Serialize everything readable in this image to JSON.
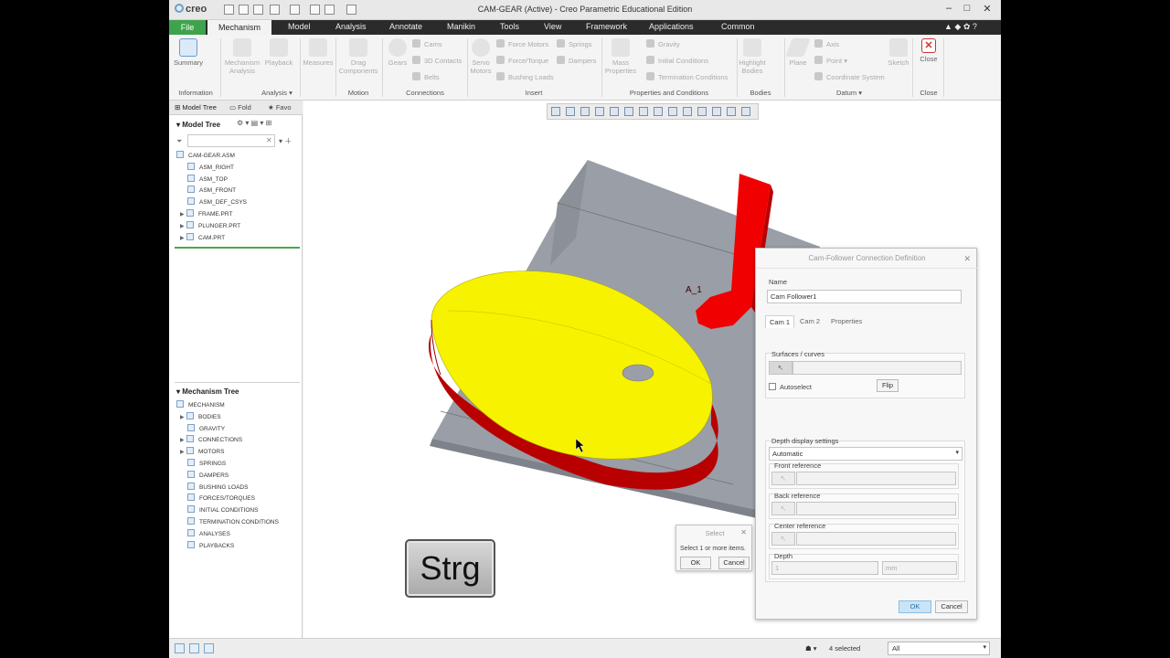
{
  "window": {
    "app_logo": "creo",
    "title": "CAM-GEAR (Active) - Creo Parametric Educational Edition"
  },
  "menu": {
    "file": "File",
    "active_tab": "Mechanism",
    "items": [
      "Model",
      "Analysis",
      "Annotate",
      "Manikin",
      "Tools",
      "View",
      "Framework",
      "Applications",
      "Common"
    ]
  },
  "ribbon": {
    "summary": "Summary",
    "mechanism_analysis": "Mechanism Analysis",
    "playback": "Playback",
    "measures": "Measures",
    "drag_components": "Drag Components",
    "gears": "Gears",
    "cams": "Cams",
    "contacts_3d": "3D Contacts",
    "belts": "Belts",
    "servo_motors": "Servo Motors",
    "force_motors": "Force Motors",
    "force_torque": "Force/Torque",
    "bushing_loads": "Bushing Loads",
    "springs": "Springs",
    "dampers": "Dampers",
    "mass_properties": "Mass Properties",
    "gravity": "Gravity",
    "initial_conditions": "Initial Conditions",
    "termination_conditions": "Termination Conditions",
    "highlight_bodies": "Highlight Bodies",
    "plane": "Plane",
    "axis": "Axis",
    "point": "Point",
    "coordinate_system": "Coordinate System",
    "sketch": "Sketch",
    "close": "Close",
    "groups": {
      "information": "Information",
      "analysis": "Analysis",
      "motion": "Motion",
      "connections": "Connections",
      "insert": "Insert",
      "properties": "Properties and Conditions",
      "bodies": "Bodies",
      "datum": "Datum",
      "close": "Close"
    }
  },
  "left_panel": {
    "tabs": [
      "Model Tree",
      "Fold",
      "Favo"
    ],
    "model_tree_header": "Model Tree",
    "model_tree": [
      "CAM-GEAR.ASM",
      "ASM_RIGHT",
      "ASM_TOP",
      "ASM_FRONT",
      "ASM_DEF_CSYS",
      "FRAME.PRT",
      "PLUNGER.PRT",
      "CAM.PRT"
    ],
    "mechanism_tree_header": "Mechanism Tree",
    "mechanism_tree": [
      "MECHANISM",
      "BODIES",
      "GRAVITY",
      "CONNECTIONS",
      "MOTORS",
      "SPRINGS",
      "DAMPERS",
      "BUSHING LOADS",
      "FORCES/TORQUES",
      "INITIAL CONDITIONS",
      "TERMINATION CONDITIONS",
      "ANALYSES",
      "PLAYBACKS"
    ]
  },
  "canvas": {
    "axis_label": "A_1",
    "key_overlay": "Strg",
    "colors": {
      "cam_top": "#f7f200",
      "cam_side": "#b80000",
      "plunger": "#f00000",
      "frame": "#9a9ea6"
    }
  },
  "dialog": {
    "title": "Cam-Follower Connection Definition",
    "name_label": "Name",
    "name_value": "Cam Follower1",
    "tabs": [
      "Cam 1",
      "Cam 2",
      "Properties"
    ],
    "surfaces_label": "Surfaces / curves",
    "autoselect_label": "Autoselect",
    "flip_button": "Flip",
    "depth_settings_label": "Depth display settings",
    "depth_mode": "Automatic",
    "front_reference": "Front reference",
    "back_reference": "Back reference",
    "center_reference": "Center reference",
    "depth_label": "Depth",
    "depth_value": "1",
    "depth_unit": "mm",
    "ok": "OK",
    "cancel": "Cancel"
  },
  "select_popup": {
    "title": "Select",
    "message": "Select 1 or more items.",
    "ok": "OK",
    "cancel": "Cancel"
  },
  "status": {
    "selected": "4 selected",
    "filter": "All"
  }
}
